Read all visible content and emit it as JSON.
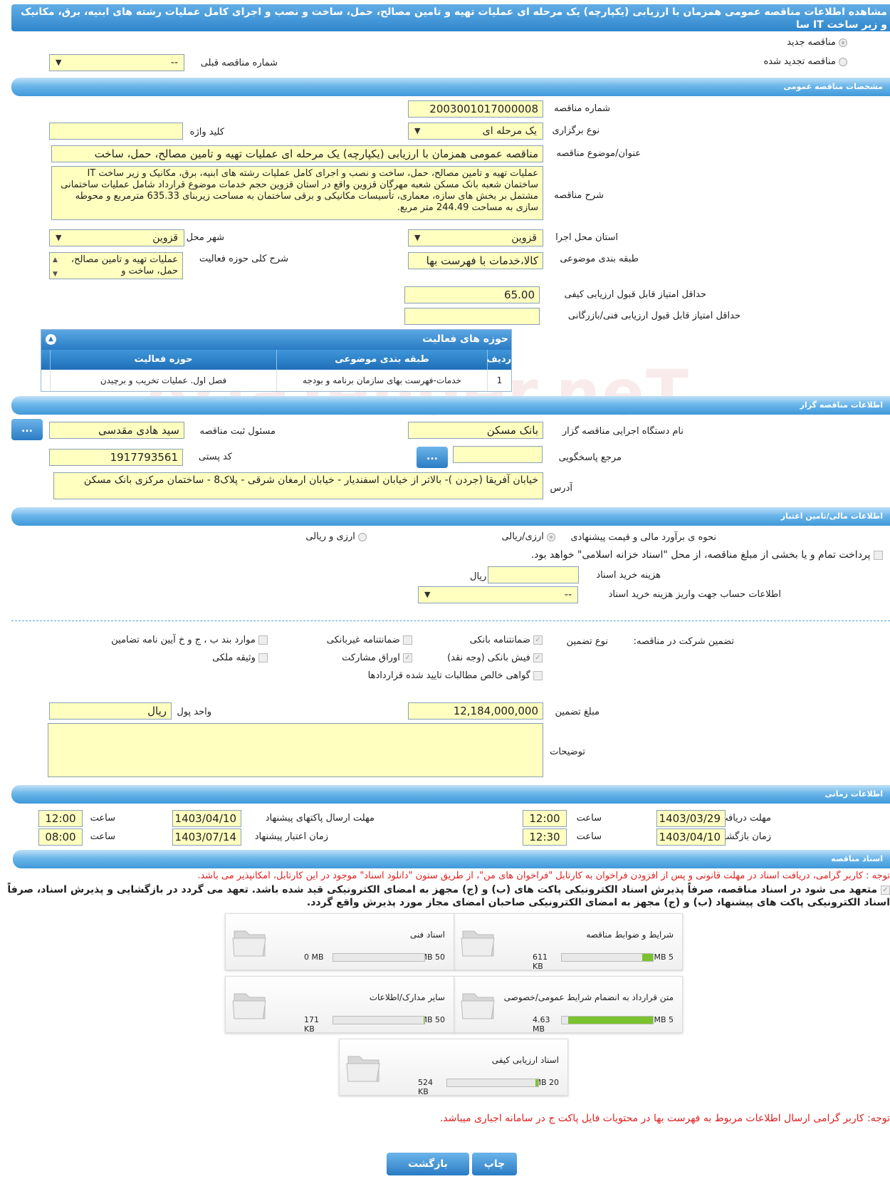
{
  "title": "مشاهده اطلاعات مناقصه عمومی همزمان با ارزیابی (یکپارچه) یک مرحله ای عملیات تهیه و تامین مصالح، حمل، ساخت و نصب و اجرای کامل عملیات رشته های ابنیه، برق، مکانیک و زیر ساخت IT سا",
  "radios": {
    "new": "مناقصه جدید",
    "renewed": "مناقصه تجدید شده"
  },
  "prev_number": {
    "label": "شماره مناقصه قبلی",
    "value": "--"
  },
  "sections": {
    "general": "مشخصات مناقصه عمومی",
    "organizer": "اطلاعات مناقصه گزار",
    "finance": "اطلاعات مالی/تامین اعتبار",
    "time": "اطلاعات زمانی",
    "docs": "اسناد مناقصه"
  },
  "general": {
    "number_label": "شماره مناقصه",
    "number": "2003001017000008",
    "type_label": "نوع برگزاری",
    "type": "یک مرحله ای",
    "keyword_label": "کلید واژه",
    "keyword": "",
    "subject_label": "عنوان/موضوع مناقصه",
    "subject": "مناقصه عمومی همزمان با ارزیابی (یکپارچه) یک مرحله ای عملیات تهیه و تامین مصالح، حمل، ساخت",
    "desc_label": "شرح مناقصه",
    "desc": "عملیات تهیه و تامین مصالح، حمل، ساخت و نصب و اجرای کامل عملیات رشته های ابنیه، برق، مکانیک و زیر ساخت IT ساختمان شعبه بانک مسکن شعبه مهرگان قزوین واقع در استان قزوین حجم خدمات موضوع قرارداد شامل عملیات ساختمانی مشتمل بر بخش های سازه، معماری، تأسیسات مکانیکی و برقی ساختمان به مساحت زیربنای  635.33 مترمربع و محوطه سازی به مساحت  244.49 متر مربع.",
    "province_label": "استان محل اجرا",
    "province": "قزوین",
    "city_label": "شهر محل اجرا",
    "city": "قزوین",
    "category_label": "طبقه بندی موضوعی",
    "category": "کالا،خدمات با فهرست بها",
    "activity_label": "شرح کلی حوزه فعالیت",
    "activity": "عملیات تهیه و تامین مصالح، حمل، ساخت و",
    "min_quality_label": "حداقل امتیاز قابل قبول ارزیابی کیفی",
    "min_quality": "65.00",
    "min_tech_label": "حداقل امتیاز قابل قبول ارزیابی فنی/بازرگانی",
    "min_tech": ""
  },
  "grid": {
    "title": "حوزه های فعالیت",
    "cols": [
      "ردیف",
      "طبقه بندی موضوعی",
      "حوزه فعالیت"
    ],
    "rows": [
      [
        "1",
        "خدمات-فهرست بهای سازمان برنامه و بودجه",
        "فصل اول. عملیات تخریب و برچیدن"
      ]
    ]
  },
  "organizer": {
    "org_label": "نام دستگاه اجرایی مناقصه گزار",
    "org": "بانک مسکن",
    "resp_label": "مسئول ثبت مناقصه",
    "resp": "سید هادی مقدسی",
    "ref_label": "مرجع پاسخگویی",
    "ref": "",
    "postal_label": "کد پستی",
    "postal": "1917793561",
    "address_label": "آدرس",
    "address": "خیابان آفریقا (جردن )- بالاتر از خیابان اسفندیار - خیابان ارمغان شرقی - پلاک8 - ساختمان مرکزی بانک مسکن",
    "dots": "..."
  },
  "finance": {
    "estimate_label": "نحوه ی برآورد مالی و قیمت پیشنهادی",
    "opt1": "ارزی/ریالی",
    "opt2": "ارزی و ریالی",
    "treasury": "پرداخت تمام و یا بخشی از مبلغ مناقصه، از محل \"اسناد خزانه اسلامی\" خواهد بود.",
    "doc_fee_label": "هزینه خرید اسناد",
    "doc_fee": "",
    "rial": "ریال",
    "account_label": "اطلاعات حساب جهت واریز هزینه خرید اسناد",
    "account": "--"
  },
  "guarantee": {
    "title": "تضمین شرکت در مناقصه:",
    "type_label": "نوع تضمین",
    "items": [
      "ضمانتنامه بانکی",
      "ضمانتنامه غیربانکی",
      "موارد بند ب ، ج و خ آیین نامه تضامین",
      "فیش بانکی (وجه نقد)",
      "اوراق مشارکت",
      "وثیقه ملکی",
      "گواهی خالص مطالبات تایید شده قراردادها"
    ],
    "amount_label": "مبلغ تضمین",
    "amount": "12,184,000,000",
    "unit_label": "واحد پول",
    "unit": "ریال",
    "notes_label": "توضیحات",
    "notes": ""
  },
  "time": {
    "receive_label": "مهلت دریافت اسناد",
    "receive_date": "1403/03/29",
    "receive_time": "12:00",
    "send_label": "مهلت ارسال پاکتهای پیشنهاد",
    "send_date": "1403/04/10",
    "send_time": "12:00",
    "open_label": "زمان بازگشایی پاکت ها",
    "open_date": "1403/04/10",
    "open_time": "12:30",
    "valid_label": "زمان اعتبار پیشنهاد",
    "valid_date": "1403/07/14",
    "valid_time": "08:00",
    "hour": "ساعت"
  },
  "docs": {
    "note1": "توجه : کاربر گرامی، دریافت اسناد در مهلت قانونی و پس از افزودن فراخوان به کارتابل \"فراخوان های من\"، از طریق ستون \"دانلود اسناد\" موجود در این کارتابل، امکانپذیر می باشد.",
    "note2": "متعهد می شود در اسناد مناقصه، صرفاً پذیرش اسناد الکترونیکی پاکت های (ب) و (ج) مجهز به امضای الکترونیکی قید شده باشد. تعهد می گردد در بازگشایی و پذیرش اسناد، صرفاً اسناد الکترونیکی پاکت های پیشنهاد (ب) و (ج) مجهز به امضای الکترونیکی صاحبان امضای مجاز مورد پذیرش واقع گردد.",
    "cards": [
      {
        "name": "شرایط و ضوابط مناقصه",
        "current": "611 KB",
        "max": "5 MB",
        "fill": 0.12
      },
      {
        "name": "اسناد فنی",
        "current": "0 MB",
        "max": "50 MB",
        "fill": 0.0
      },
      {
        "name": "متن قرارداد به انضمام شرایط عمومی/خصوصی",
        "current": "4.63 MB",
        "max": "5 MB",
        "fill": 0.93
      },
      {
        "name": "سایر مدارک/اطلاعات",
        "current": "171 KB",
        "max": "50 MB",
        "fill": 0.01
      },
      {
        "name": "اسناد ارزیابی کیفی",
        "current": "524 KB",
        "max": "20 MB",
        "fill": 0.03
      }
    ],
    "note3": "توجه: کاربر گرامی ارسال اطلاعات مربوط به فهرست بها در محتویات فایل پاکت ج در سامانه اجباری میباشد."
  },
  "buttons": {
    "print": "چاپ",
    "back": "بازگشت"
  },
  "watermark": "AriaTender.neT"
}
